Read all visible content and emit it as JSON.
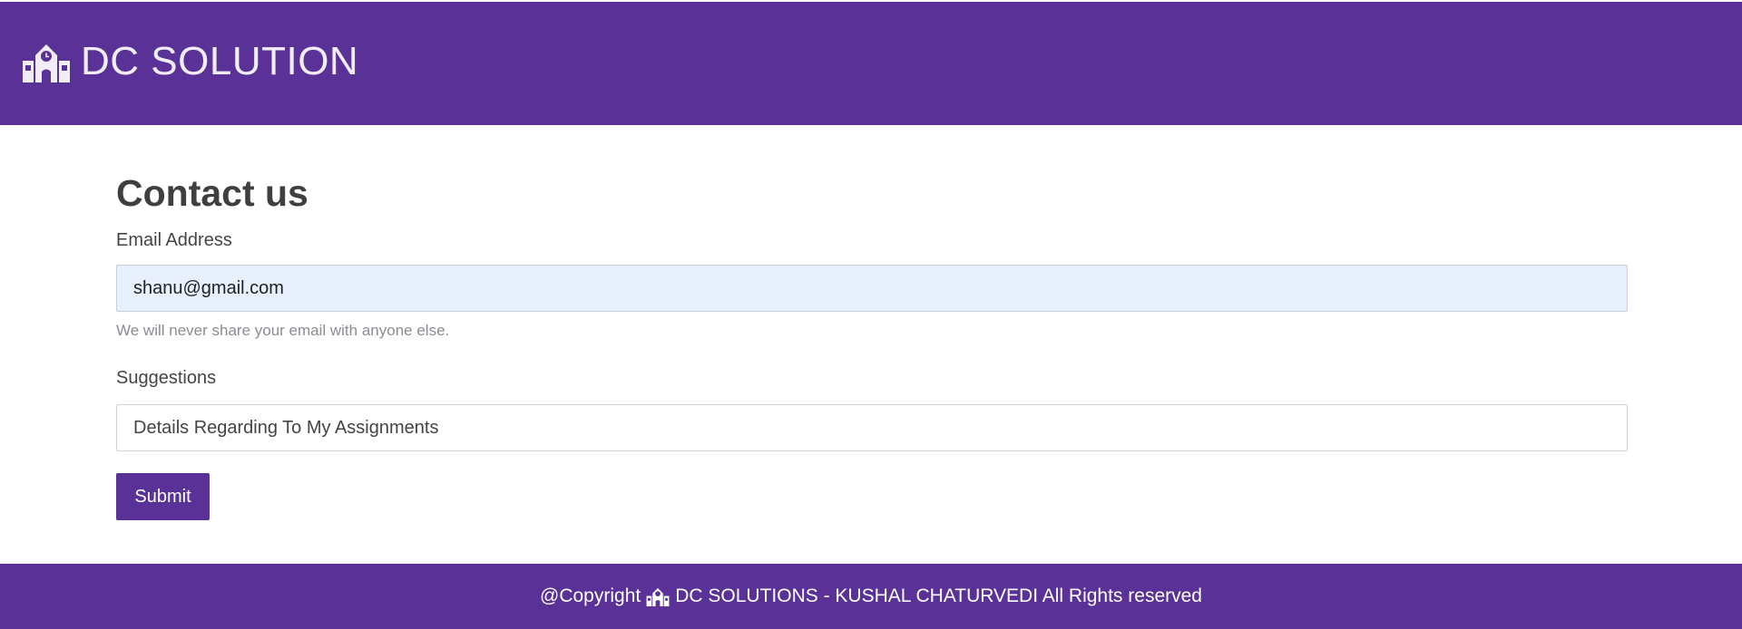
{
  "header": {
    "brand_title": "DC SOLUTION",
    "brand_icon": "school-icon"
  },
  "main": {
    "title": "Contact us",
    "email_label": "Email Address",
    "email_value": "shanu@gmail.com",
    "email_help": "We will never share your email with anyone else.",
    "suggestions_label": "Suggestions",
    "suggestions_value": "Details Regarding To My Assignments",
    "submit_label": "Submit"
  },
  "footer": {
    "prefix": "@Copyright",
    "icon": "school-icon",
    "text": "DC SOLUTIONS - KUSHAL CHATURVEDI All Rights reserved"
  },
  "colors": {
    "brand_purple": "#5a3196",
    "email_field_bg": "#e8f0fd",
    "heading_text": "#3f3f3f",
    "help_text": "#8a8d92"
  }
}
